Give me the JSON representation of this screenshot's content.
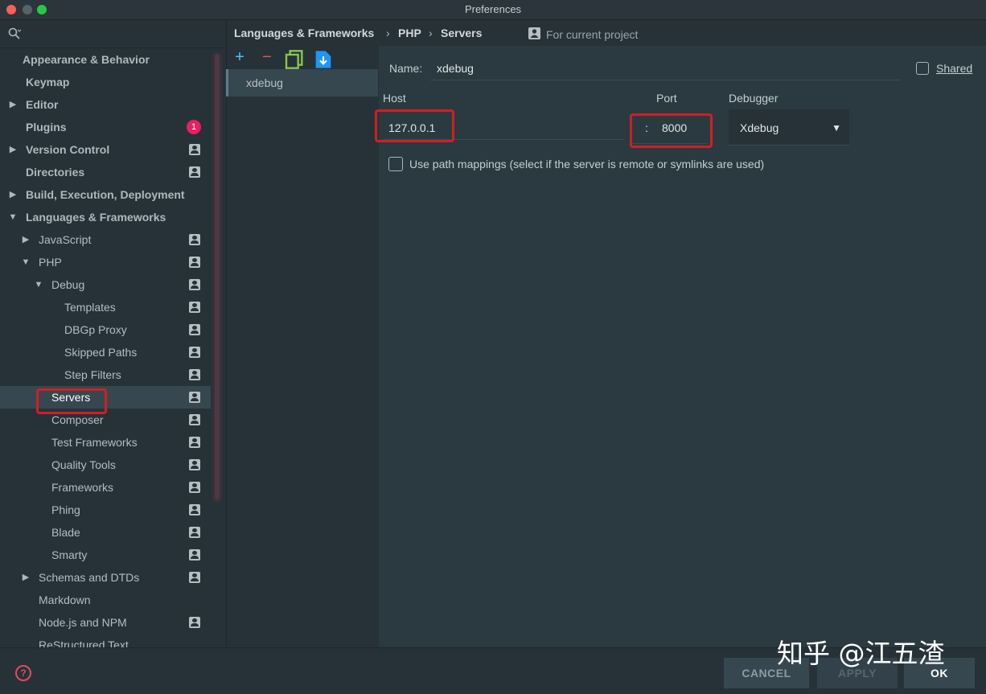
{
  "window": {
    "title": "Preferences"
  },
  "sidebar": {
    "items": [
      {
        "label": "Appearance & Behavior",
        "arrow": "",
        "bold": true,
        "project": false,
        "badge": ""
      },
      {
        "label": "Keymap",
        "arrow": "",
        "bold": true,
        "project": false,
        "badge": ""
      },
      {
        "label": "Editor",
        "arrow": "▶",
        "bold": true,
        "project": false,
        "badge": ""
      },
      {
        "label": "Plugins",
        "arrow": "",
        "bold": true,
        "project": false,
        "badge": "1"
      },
      {
        "label": "Version Control",
        "arrow": "▶",
        "bold": true,
        "project": true,
        "badge": ""
      },
      {
        "label": "Directories",
        "arrow": "",
        "bold": true,
        "project": true,
        "badge": ""
      },
      {
        "label": "Build, Execution, Deployment",
        "arrow": "▶",
        "bold": true,
        "project": false,
        "badge": ""
      },
      {
        "label": "Languages & Frameworks",
        "arrow": "▼",
        "bold": true,
        "project": false,
        "badge": ""
      },
      {
        "label": "JavaScript",
        "arrow": "▶",
        "bold": false,
        "project": true,
        "badge": ""
      },
      {
        "label": "PHP",
        "arrow": "▼",
        "bold": false,
        "project": true,
        "badge": ""
      },
      {
        "label": "Debug",
        "arrow": "▼",
        "bold": false,
        "project": true,
        "badge": ""
      },
      {
        "label": "Templates",
        "arrow": "",
        "bold": false,
        "project": true,
        "badge": ""
      },
      {
        "label": "DBGp Proxy",
        "arrow": "",
        "bold": false,
        "project": true,
        "badge": ""
      },
      {
        "label": "Skipped Paths",
        "arrow": "",
        "bold": false,
        "project": true,
        "badge": ""
      },
      {
        "label": "Step Filters",
        "arrow": "",
        "bold": false,
        "project": true,
        "badge": ""
      },
      {
        "label": "Servers",
        "arrow": "",
        "bold": false,
        "project": true,
        "badge": "",
        "selected": true
      },
      {
        "label": "Composer",
        "arrow": "",
        "bold": false,
        "project": true,
        "badge": ""
      },
      {
        "label": "Test Frameworks",
        "arrow": "",
        "bold": false,
        "project": true,
        "badge": ""
      },
      {
        "label": "Quality Tools",
        "arrow": "",
        "bold": false,
        "project": true,
        "badge": ""
      },
      {
        "label": "Frameworks",
        "arrow": "",
        "bold": false,
        "project": true,
        "badge": ""
      },
      {
        "label": "Phing",
        "arrow": "",
        "bold": false,
        "project": true,
        "badge": ""
      },
      {
        "label": "Blade",
        "arrow": "",
        "bold": false,
        "project": true,
        "badge": ""
      },
      {
        "label": "Smarty",
        "arrow": "",
        "bold": false,
        "project": true,
        "badge": ""
      },
      {
        "label": "Schemas and DTDs",
        "arrow": "▶",
        "bold": false,
        "project": true,
        "badge": ""
      },
      {
        "label": "Markdown",
        "arrow": "",
        "bold": false,
        "project": false,
        "badge": ""
      },
      {
        "label": "Node.js and NPM",
        "arrow": "",
        "bold": false,
        "project": true,
        "badge": ""
      },
      {
        "label": "ReStructured Text",
        "arrow": "",
        "bold": false,
        "project": false,
        "badge": ""
      }
    ]
  },
  "breadcrumb": {
    "items": [
      "Languages & Frameworks",
      "PHP",
      "Servers"
    ],
    "separator": "›",
    "scope": "For current project"
  },
  "toolbar": {
    "add": "+",
    "remove": "−"
  },
  "servers": {
    "items": [
      "xdebug"
    ]
  },
  "form": {
    "name_label": "Name:",
    "name_value": "xdebug",
    "shared_label": "Shared",
    "host_label": "Host",
    "host_value": "127.0.0.1",
    "port_label": "Port",
    "port_colon": ":",
    "port_value": "8000",
    "debugger_label": "Debugger",
    "debugger_value": "Xdebug",
    "path_mappings_label": "Use path mappings (select if the server is remote or symlinks are used)"
  },
  "buttons": {
    "cancel": "CANCEL",
    "apply": "APPLY",
    "ok": "OK"
  },
  "help": {
    "glyph": "?"
  },
  "watermark": "知乎 @江五渣",
  "colors": {
    "accent_red": "#d11f24",
    "badge": "#e91e63",
    "add": "#4fc3f7",
    "remove": "#ef5350",
    "copy": "#8bc34a"
  }
}
